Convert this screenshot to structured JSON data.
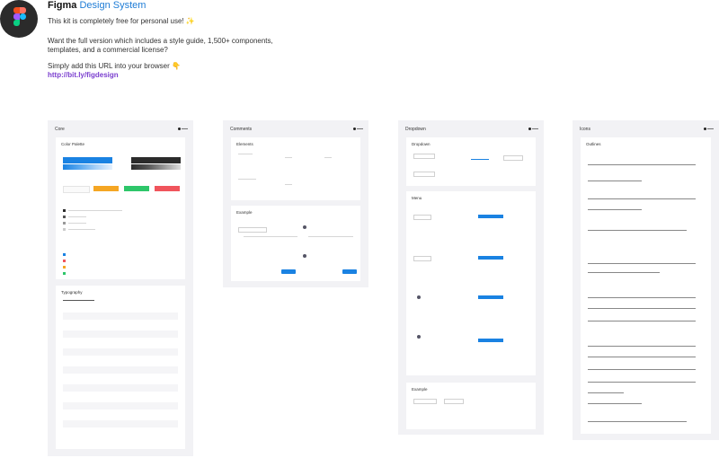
{
  "header": {
    "title_prefix": "Figma",
    "title_accent": "Design System",
    "line1": "This kit is completely free for personal use! ✨",
    "line2": "Want the full version which includes a style guide, 1,500+ components,",
    "line3": "templates, and a commercial license?",
    "line4": "Simply add this URL into your browser 👇",
    "link": "http://bit.ly/figdesign",
    "accent_color": "#1e7cd6",
    "link_color": "#7b3fcf"
  },
  "frames": {
    "core": {
      "title": "Core",
      "card1_title": "Color Palette",
      "card2_title": "Typography"
    },
    "comments": {
      "title": "Comments",
      "card1_title": "Elements",
      "card2_title": "Example"
    },
    "dropdown": {
      "title": "Dropdown",
      "card1_title": "Dropdown",
      "card2_title": "Menu",
      "card3_title": "Example"
    },
    "icons": {
      "title": "Icons",
      "card1_title": "Outlines"
    }
  },
  "colors": {
    "blue": "#1a82e2",
    "dark": "#2b2b2b",
    "yellow": "#f5a623",
    "green": "#2ec66a",
    "red": "#f0545c"
  }
}
